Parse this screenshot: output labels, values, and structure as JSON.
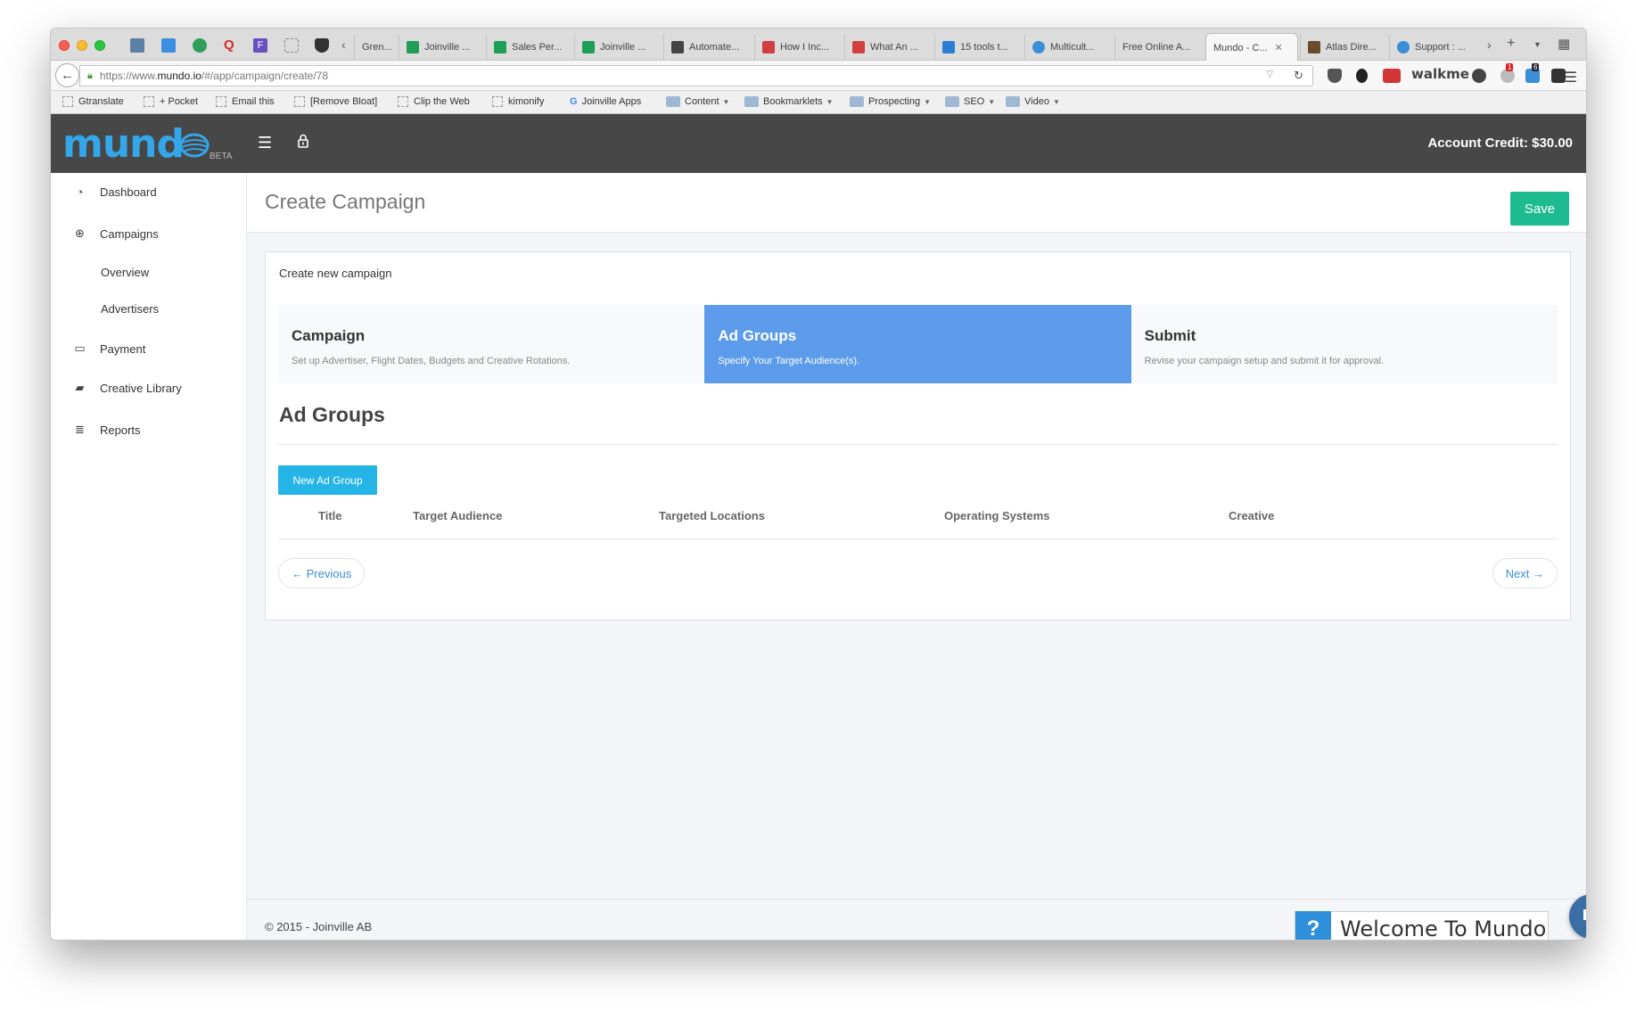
{
  "browser": {
    "tabs": [
      {
        "label": "Gren...",
        "color": "#8a8a8a"
      },
      {
        "label": "Joinville ...",
        "color": "#1e9e56"
      },
      {
        "label": "Sales Per...",
        "color": "#1e9e56"
      },
      {
        "label": "Joinville ...",
        "color": "#1e9e56"
      },
      {
        "label": "Automate...",
        "color": "#444444"
      },
      {
        "label": "How I Inc...",
        "color": "#d23f3f"
      },
      {
        "label": "What An ...",
        "color": "#d23f3f"
      },
      {
        "label": "15 tools t...",
        "color": "#2a7fd4"
      },
      {
        "label": "Multicult...",
        "color": "#3a8fd8"
      },
      {
        "label": "Free Online A...",
        "color": ""
      },
      {
        "label": "Mundo - C...",
        "color": ""
      },
      {
        "label": "Atlas Dire...",
        "color": "#6b4a2e"
      },
      {
        "label": "Support : ...",
        "color": "#3a8fd8"
      }
    ],
    "url_prefix": "https://www.",
    "url_domain": "mundo.io",
    "url_path": "/#/app/campaign/create/78",
    "extension_walkme": "walkme",
    "ext_badge_1": "1",
    "ext_badge_2": "6",
    "bookmarks": [
      {
        "label": "Gtranslate",
        "type": "page"
      },
      {
        "label": "+ Pocket",
        "type": "page"
      },
      {
        "label": "Email this",
        "type": "page"
      },
      {
        "label": "[Remove Bloat]",
        "type": "page"
      },
      {
        "label": "Clip the Web",
        "type": "page"
      },
      {
        "label": "kimonify",
        "type": "page"
      },
      {
        "label": "Joinville Apps",
        "type": "google"
      },
      {
        "label": "Content",
        "type": "folder"
      },
      {
        "label": "Bookmarklets",
        "type": "folder"
      },
      {
        "label": "Prospecting",
        "type": "folder"
      },
      {
        "label": "SEO",
        "type": "folder"
      },
      {
        "label": "Video",
        "type": "folder"
      }
    ]
  },
  "app": {
    "logo_text": "mund",
    "beta_label": "BETA",
    "account_credit": "Account Credit: $30.00",
    "brand_color": "#34a6ea"
  },
  "sidebar": {
    "items": [
      {
        "label": "Dashboard",
        "icon": "dashboard-icon"
      },
      {
        "label": "Campaigns",
        "icon": "globe-icon"
      },
      {
        "label": "Overview",
        "icon": ""
      },
      {
        "label": "Advertisers",
        "icon": ""
      },
      {
        "label": "Payment",
        "icon": "credit-card-icon"
      },
      {
        "label": "Creative Library",
        "icon": "book-icon"
      },
      {
        "label": "Reports",
        "icon": "database-icon"
      }
    ]
  },
  "page": {
    "title": "Create Campaign",
    "save_label": "Save",
    "panel_heading": "Create new campaign",
    "steps": [
      {
        "title": "Campaign",
        "desc": "Set up Advertiser, Flight Dates, Budgets and Creative Rotations.",
        "active": false
      },
      {
        "title": "Ad Groups",
        "desc": "Specify Your Target Audience(s).",
        "active": true
      },
      {
        "title": "Submit",
        "desc": "Revise your campaign setup and submit it for approval.",
        "active": false
      }
    ],
    "section_title": "Ad Groups",
    "new_group_label": "New Ad Group",
    "columns": [
      "Title",
      "Target Audience",
      "Targeted Locations",
      "Operating Systems",
      "Creative"
    ],
    "prev_label": "← Previous",
    "next_label": "Next →",
    "copyright": "© 2015 - Joinville AB",
    "welcome_q": "?",
    "welcome_text": "Welcome To Mundo",
    "accent_save": "#1dbb8f",
    "accent_step": "#5b9be9",
    "accent_new": "#24b5e6"
  }
}
